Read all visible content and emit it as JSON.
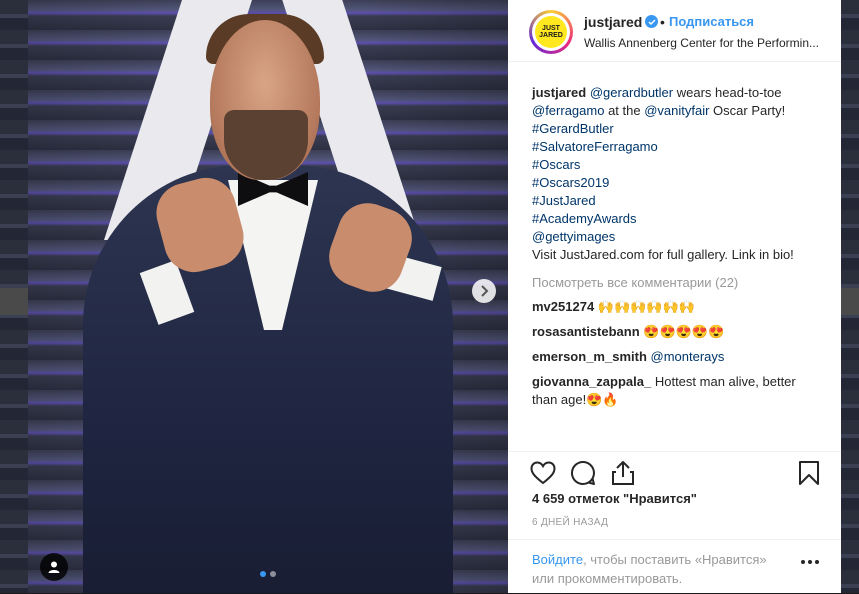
{
  "post": {
    "username": "justjared",
    "follow_label": "Подписаться",
    "separator": "•",
    "location": "Wallis Annenberg Center for the Performin...",
    "avatar_text_line1": "JUST",
    "avatar_text_line2": "JARED"
  },
  "caption": {
    "username": "justjared",
    "mention1": "@gerardbutler",
    "text1": " wears head-to-toe ",
    "mention2": "@ferragamo",
    "text2": " at the ",
    "mention3": "@vanityfair",
    "text3": " Oscar Party!",
    "hashtags": [
      "#GerardButler",
      "#SalvatoreFerragamo",
      "#Oscars",
      "#Oscars2019",
      "#JustJared",
      "#AcademyAwards"
    ],
    "credit": "@gettyimages",
    "closing": "Visit JustJared.com for full gallery. Link in bio!"
  },
  "view_all_comments": "Посмотреть все комментарии (22)",
  "comments": [
    {
      "user": "mv251274",
      "text": "🙌🙌🙌🙌🙌🙌"
    },
    {
      "user": "rosasantistebann",
      "text": "😍😍😍😍😍"
    },
    {
      "user": "emerson_m_smith",
      "text": "@monterays"
    },
    {
      "user": "giovanna_zappala_",
      "text": "Hottest man alive, better than age!😍🔥"
    }
  ],
  "likes": "4 659 отметок \"Нравится\"",
  "timestamp": "6 ДНЕЙ НАЗАД",
  "login": {
    "link": "Войдите",
    "text": ", чтобы поставить «Нравится» или прокомментировать."
  },
  "carousel": {
    "total": 2,
    "active": 1
  },
  "icons": {
    "like": "heart-icon",
    "comment": "comment-icon",
    "share": "share-icon",
    "save": "bookmark-icon",
    "next": "chevron-right-icon",
    "tag": "user-tag-icon",
    "more": "more-options-icon",
    "verified": "verified-badge-icon"
  },
  "colors": {
    "accent": "#3897f0",
    "link": "#003569",
    "muted": "#999999",
    "text": "#262626"
  }
}
